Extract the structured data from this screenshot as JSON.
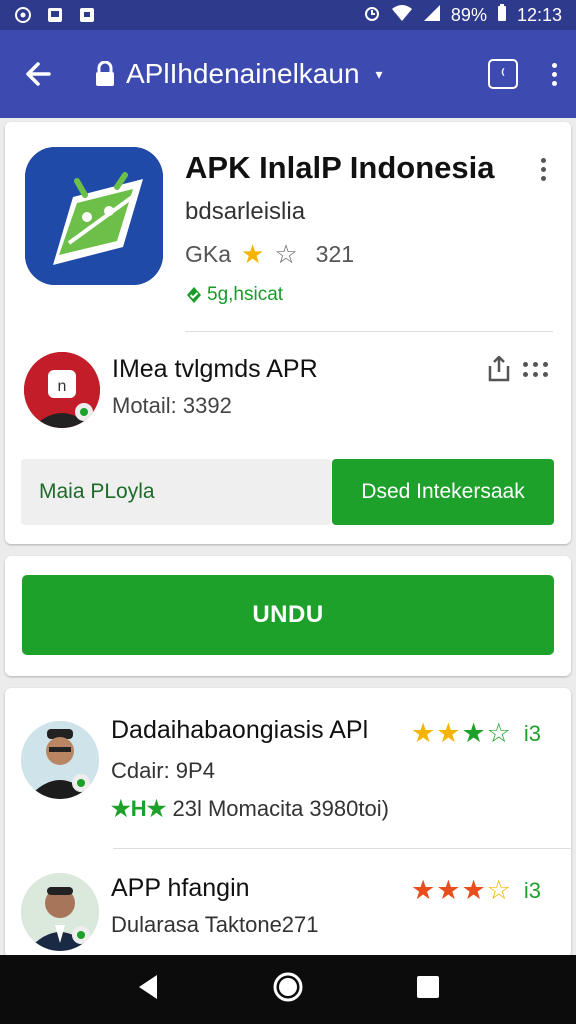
{
  "status_bar": {
    "battery": "89%",
    "time": "12:13"
  },
  "app_bar": {
    "url": "APlIhdenainelkaun"
  },
  "app": {
    "title": "APK InlalP Indonesia",
    "developer": "bdsarleislia",
    "rating_label": "GKa",
    "rating_count": "321",
    "verified": "5g,hsicat",
    "stars": {
      "filled": 1,
      "total": 2
    }
  },
  "publisher": {
    "name": "IMea tvlgmds APR",
    "meta": "Motail: 3392"
  },
  "buttons": {
    "secondary": "Maia PLoyla",
    "primary": "Dsed Intekersaak",
    "install": "UNDU"
  },
  "reviews": [
    {
      "title": "Dadaihabaongiasis APl",
      "subtitle": "Cdair: 9P4",
      "meta_prefix": "★H★",
      "meta": "23l Momacita 3980toi)",
      "stars": "3",
      "count": "i3",
      "star_color": "#f4b400"
    },
    {
      "title": "APP hfangin",
      "subtitle": "Dularasa Taktone271",
      "stars": "3",
      "count": "i3",
      "star_color": "#ea4d1c"
    }
  ],
  "colors": {
    "status_bar": "#2e3a8c",
    "app_bar": "#3d4bb0",
    "accent_green": "#1ea12b",
    "star_yellow": "#f4b400",
    "star_orange": "#ea4d1c"
  }
}
